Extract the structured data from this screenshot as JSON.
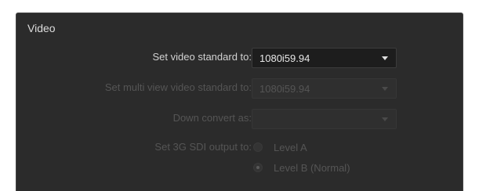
{
  "panel": {
    "title": "Video"
  },
  "fields": {
    "video_standard": {
      "label": "Set video standard to:",
      "value": "1080i59.94",
      "enabled": true
    },
    "multiview_standard": {
      "label": "Set multi view video standard to:",
      "value": "1080i59.94",
      "enabled": false
    },
    "down_convert": {
      "label": "Down convert as:",
      "value": "",
      "enabled": false
    },
    "sdi_output": {
      "label": "Set 3G SDI output to:",
      "enabled": false,
      "options": [
        {
          "label": "Level A",
          "selected": false
        },
        {
          "label": "Level B (Normal)",
          "selected": true
        }
      ]
    }
  },
  "colors": {
    "panel_background": "#2b2b2b",
    "active_text": "#d2d2d2",
    "disabled_text": "#555555"
  },
  "icons": {
    "dropdown": "chevron-down-icon"
  }
}
